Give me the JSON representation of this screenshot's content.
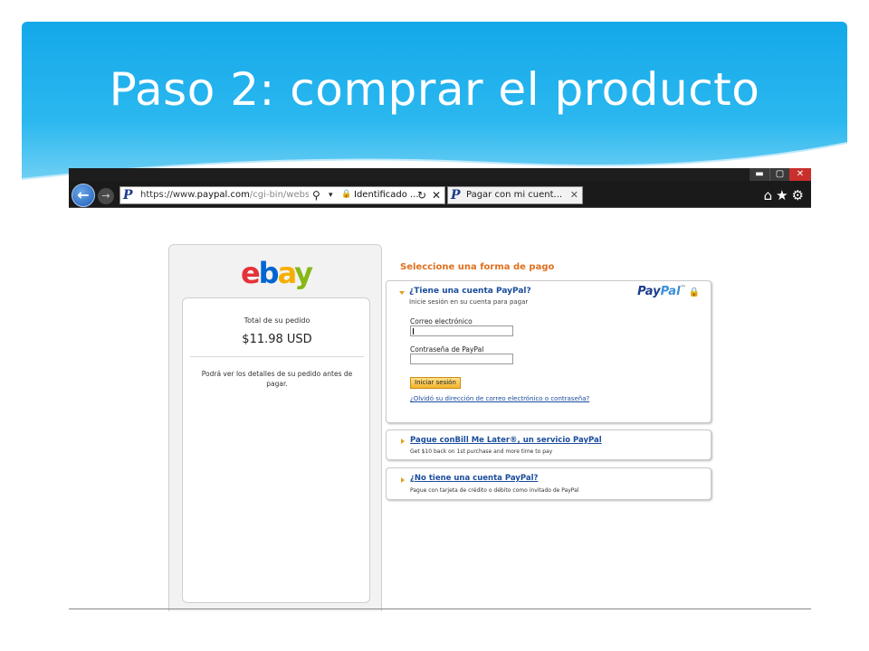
{
  "slide": {
    "title": "Paso 2: comprar el producto"
  },
  "browser": {
    "window_buttons": {
      "minimize": "▬",
      "maximize": "▢",
      "close": "✕"
    },
    "back_icon": "←",
    "forward_icon": "→",
    "address": {
      "scheme": "https://www.",
      "domain": "paypal.com",
      "path": "/cgi-bin/webscr?c",
      "search_icon": "⚲",
      "dropdown_icon": "▾",
      "lock_icon": "🔒",
      "security_label": "Identificado ...",
      "refresh_icon": "↻",
      "stop_icon": "✕"
    },
    "favicon": "P",
    "tab": {
      "title": "Pagar con mi cuent...",
      "close_icon": "✕"
    },
    "right_icons": "⌂★⚙"
  },
  "checkout": {
    "logo": {
      "e": "e",
      "b": "b",
      "a": "a",
      "y": "y"
    },
    "order": {
      "label": "Total de su pedido",
      "total": "$11.98 USD",
      "note": "Podrá ver los detalles de su pedido antes de pagar."
    },
    "heading": "Seleccione una forma de pago",
    "paypal_account": {
      "title": "¿Tiene una cuenta PayPal?",
      "subtitle": "Inicie sesión en su cuenta para pagar",
      "logo_pay": "Pay",
      "logo_pal": "Pal",
      "logo_tm": "™",
      "lock_icon": "🔒",
      "email_label": "Correo electrónico",
      "email_value": "",
      "password_label": "Contraseña de PayPal",
      "password_value": "",
      "login_button": "Iniciar sesión",
      "forgot_link": "¿Olvidó su dirección de correo electrónico o contraseña?"
    },
    "bill_me_later": {
      "title": "Pague conBill Me Later®, un servicio PayPal",
      "subtitle": "Get $10 back on 1st purchase and more time to pay"
    },
    "no_account": {
      "title": "¿No tiene una cuenta PayPal?",
      "subtitle": "Pague con tarjeta de crédito o débito como invitado de PayPal"
    }
  },
  "colors": {
    "header_blue": "#14a8ea",
    "heading_orange": "#e0701e",
    "link_blue": "#1a4c9c",
    "button_gold": "#f3b42a"
  }
}
